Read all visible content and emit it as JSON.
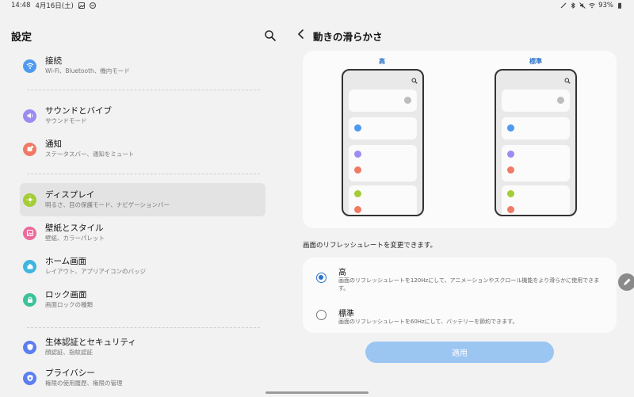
{
  "status_bar": {
    "time": "14:48",
    "date": "4月16日(土)",
    "battery": "93%",
    "icons": [
      "gallery-icon",
      "dnd-icon",
      "pen-icon",
      "bluetooth-icon",
      "mute-icon",
      "wifi-icon",
      "battery-icon"
    ]
  },
  "settings": {
    "title": "設定",
    "search_icon": "search-icon",
    "items": [
      {
        "title": "接続",
        "sub": "Wi-Fi、Bluetooth、機内モード",
        "icon": "wifi-icon",
        "color": "#4f9af0"
      },
      {
        "title": "サウンドとバイブ",
        "sub": "サウンドモード",
        "icon": "volume-icon",
        "color": "#9a8cf0"
      },
      {
        "title": "通知",
        "sub": "ステータスバー、通知をミュート",
        "icon": "notification-icon",
        "color": "#f07a64"
      },
      {
        "title": "ディスプレイ",
        "sub": "明るさ、目の保護モード、ナビゲーションバー",
        "icon": "display-icon",
        "color": "#a4cc35"
      },
      {
        "title": "壁紙とスタイル",
        "sub": "壁紙、カラーパレット",
        "icon": "wallpaper-icon",
        "color": "#ec6a9a"
      },
      {
        "title": "ホーム画面",
        "sub": "レイアウト、アプリアイコンのバッジ",
        "icon": "home-icon",
        "color": "#3fb6e0"
      },
      {
        "title": "ロック画面",
        "sub": "画面ロックの種類",
        "icon": "lock-icon",
        "color": "#3cc29b"
      },
      {
        "title": "生体認証とセキュリティ",
        "sub": "顔認証、指紋認証",
        "icon": "shield-icon",
        "color": "#5b7ef0"
      },
      {
        "title": "プライバシー",
        "sub": "権限の使用履歴、権限の管理",
        "icon": "privacy-icon",
        "color": "#5b7ef0"
      }
    ]
  },
  "detail": {
    "title": "動きの滑らかさ",
    "back_icon": "back-icon",
    "preview": {
      "high_label": "高",
      "standard_label": "標準"
    },
    "description": "画面のリフレッシュレートを変更できます。",
    "options": [
      {
        "title": "高",
        "desc": "画面のリフレッシュレートを120Hzにして、アニメーションやスクロール機能をより滑らかに使用できます。",
        "selected": true
      },
      {
        "title": "標準",
        "desc": "画面のリフレッシュレートを60Hzにして、バッテリーを節約できます。",
        "selected": false
      }
    ],
    "apply_label": "適用"
  },
  "colors": {
    "accent": "#2a73c8",
    "apply_button": "#9cc6f2",
    "dot_blue": "#4f9af0",
    "dot_purple": "#9a8cf0",
    "dot_red": "#f07a64",
    "dot_green": "#a4cc35"
  }
}
